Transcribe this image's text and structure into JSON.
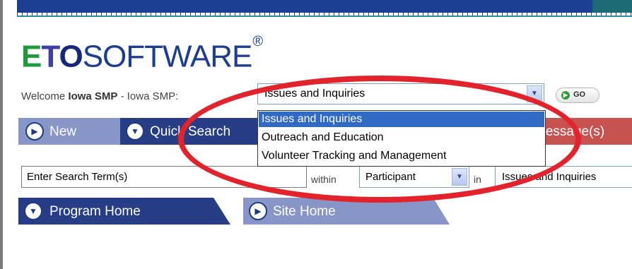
{
  "brand": {
    "logo_e": "E",
    "logo_t": "T",
    "logo_o": "O",
    "logo_rest": "SOFTWARE",
    "logo_mark": "®"
  },
  "welcome": {
    "prefix": "Welcome ",
    "user": "Iowa SMP",
    "suffix": " - Iowa SMP:"
  },
  "program_select": {
    "value": "Issues and Inquiries",
    "options": [
      "Issues and Inquiries",
      "Outreach and Education",
      "Volunteer Tracking and Management"
    ]
  },
  "go_button": {
    "label": "GO"
  },
  "nav_tabs": {
    "new": "New",
    "quick_search": "Quick Search",
    "messages": "Message(s)"
  },
  "search": {
    "term_value": "Enter Search Term(s)",
    "within_label": "within",
    "scope_value": "Participant",
    "in_label": "in",
    "program_value": "Issues and Inquiries"
  },
  "home_tabs": {
    "program_home": "Program Home",
    "site_home": "Site Home"
  },
  "colors": {
    "nav_dark": "#273d86",
    "nav_light": "#8895c7",
    "messages_tab": "#c65350",
    "annotation_ring": "#e3232b",
    "selection": "#316ac5"
  },
  "icons": {
    "tab_icon": "arrow-circle-icon",
    "dropdown": "chevron-down-icon",
    "go_icon": "arrow-circle-icon"
  }
}
